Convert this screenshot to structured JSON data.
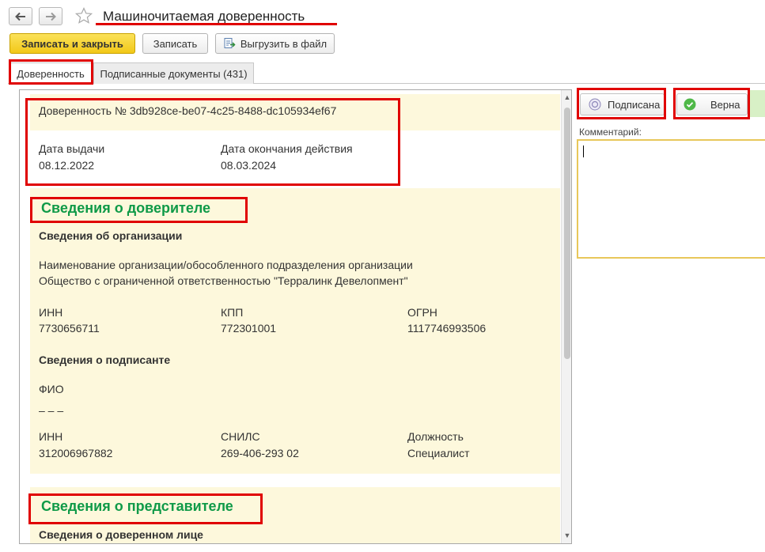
{
  "window": {
    "title": "Машиночитаемая доверенность"
  },
  "nav": {
    "back_icon": "arrow-left-icon",
    "forward_icon": "arrow-right-icon",
    "favorite_icon": "star-icon"
  },
  "toolbar": {
    "save_close_label": "Записать и закрыть",
    "save_label": "Записать",
    "export_label": "Выгрузить в файл",
    "export_icon": "export-file-icon"
  },
  "tabs": [
    {
      "label": "Доверенность",
      "active": true
    },
    {
      "label": "Подписанные документы (431)",
      "active": false
    }
  ],
  "document": {
    "header": "Доверенность № 3db928ce-be07-4c25-8488-dc105934ef67",
    "issue_date_label": "Дата выдачи",
    "issue_date": "08.12.2022",
    "expiry_label": "Дата окончания действия",
    "expiry_date": "08.03.2024",
    "principal_section": "Сведения о доверителе",
    "org_section": "Сведения об организации",
    "org_name_label": "Наименование организации/обособленного подразделения организации",
    "org_name": "Общество с ограниченной ответственностью \"Терралинк Девелопмент\"",
    "inn_label": "ИНН",
    "inn": "7730656711",
    "kpp_label": "КПП",
    "kpp": "772301001",
    "ogrn_label": "ОГРН",
    "ogrn": "1117746993506",
    "signer_section": "Сведения о подписанте",
    "fio_label": "ФИО",
    "fio": "– – –",
    "signer_inn_label": "ИНН",
    "signer_inn": "312006967882",
    "snils_label": "СНИЛС",
    "snils": "269-406-293 02",
    "position_label": "Должность",
    "position": "Специалист",
    "representative_section": "Сведения о представителе",
    "trustee_section": "Сведения о доверенном лице"
  },
  "status": {
    "signed_label": "Подписана",
    "signed_icon": "signature-icon",
    "valid_label": "Верна",
    "valid_icon": "check-circle-icon"
  },
  "comment": {
    "label": "Комментарий:",
    "value": ""
  },
  "colors": {
    "accent_yellow": "#f5cf2a",
    "section_green": "#0f9a48",
    "band_background": "#fdf8dc",
    "annotation_red": "#e00000"
  }
}
